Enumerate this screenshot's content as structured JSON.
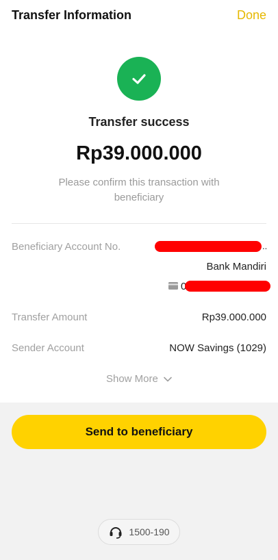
{
  "header": {
    "title": "Transfer Information",
    "done_label": "Done"
  },
  "status": {
    "title": "Transfer success",
    "amount": "Rp39.000.000",
    "subtitle": "Please confirm this transaction with beneficiary",
    "icon": "check-icon",
    "color": "#1ab255"
  },
  "details": {
    "beneficiary_label": "Beneficiary Account No.",
    "bank_name": "Bank Mandiri",
    "account_prefix": "0",
    "transfer_amount_label": "Transfer Amount",
    "transfer_amount_value": "Rp39.000.000",
    "sender_label": "Sender Account",
    "sender_value": "NOW Savings (1029)"
  },
  "show_more_label": "Show More",
  "send_button_label": "Send to beneficiary",
  "hotline_number": "1500-190",
  "colors": {
    "accent": "#ffd200",
    "done": "#e6b800",
    "redaction": "#ff0000"
  }
}
